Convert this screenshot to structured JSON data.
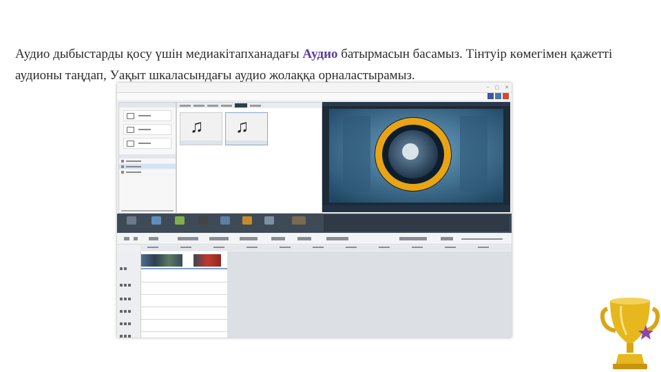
{
  "text": {
    "part1": "Аудио дыбыстарды қосу үшін медиакітапханадағы ",
    "highlight": "Аудио",
    "part2": " батырмасын басамыз. Тінтуір көмегімен қажетті аудионы таңдап, Уақыт шкаласындағы аудио жолаққа орналастырамыз."
  },
  "colors": {
    "highlight": "#5b3aa0",
    "toolbar": "#3f4a57",
    "speaker_ring": "#e8a415",
    "trophy": "#e6b81e"
  },
  "icons": {
    "library_tile": "music-note-icon",
    "decoration": "trophy-icon"
  }
}
